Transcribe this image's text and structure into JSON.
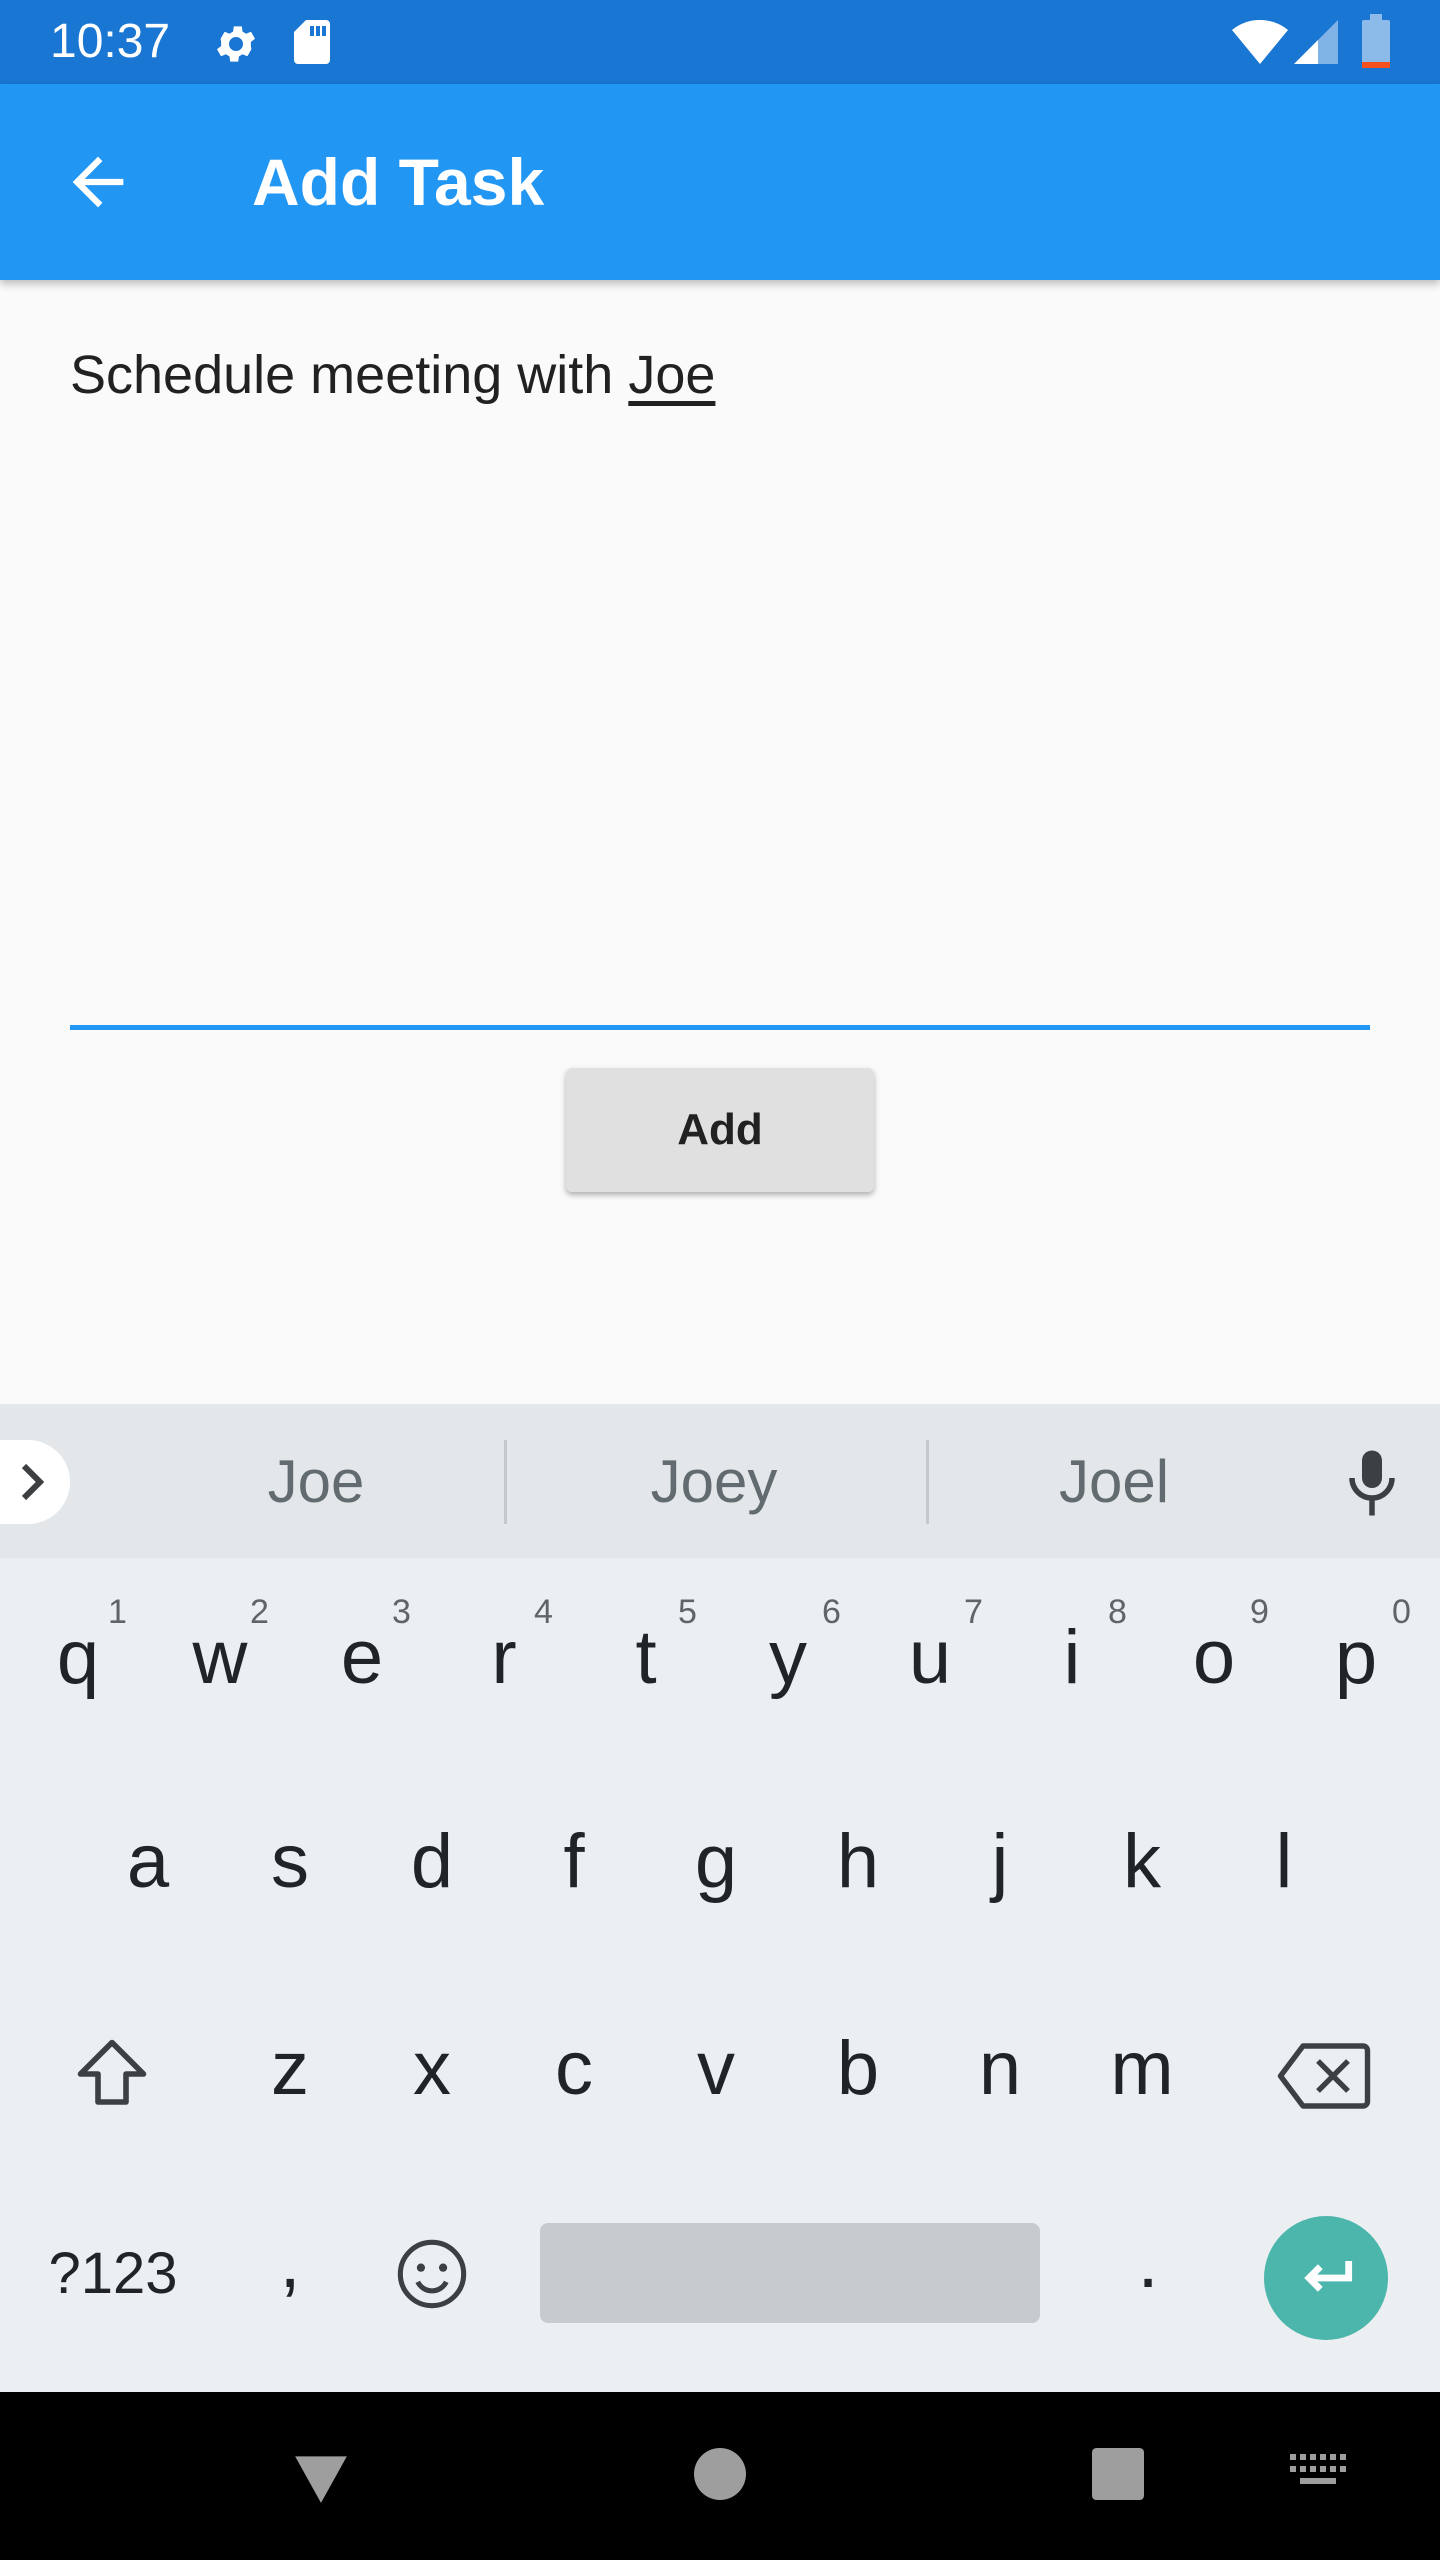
{
  "status_bar": {
    "time": "10:37"
  },
  "app_bar": {
    "title": "Add Task"
  },
  "task_input": {
    "text_prefix": "Schedule meeting with ",
    "text_underlined": "Joe"
  },
  "add_button": {
    "label": "Add"
  },
  "keyboard": {
    "suggestions": [
      "Joe",
      "Joey",
      "Joel"
    ],
    "row1": [
      "q",
      "w",
      "e",
      "r",
      "t",
      "y",
      "u",
      "i",
      "o",
      "p"
    ],
    "row1_hints": [
      "1",
      "2",
      "3",
      "4",
      "5",
      "6",
      "7",
      "8",
      "9",
      "0"
    ],
    "row2": [
      "a",
      "s",
      "d",
      "f",
      "g",
      "h",
      "j",
      "k",
      "l"
    ],
    "row3": [
      "z",
      "x",
      "c",
      "v",
      "b",
      "n",
      "m"
    ],
    "symbols_label": "?123",
    "comma": ",",
    "period": ".",
    "accent": "#4db6ac"
  },
  "colors": {
    "status_bar": "#1976d2",
    "app_bar": "#2196f3"
  }
}
